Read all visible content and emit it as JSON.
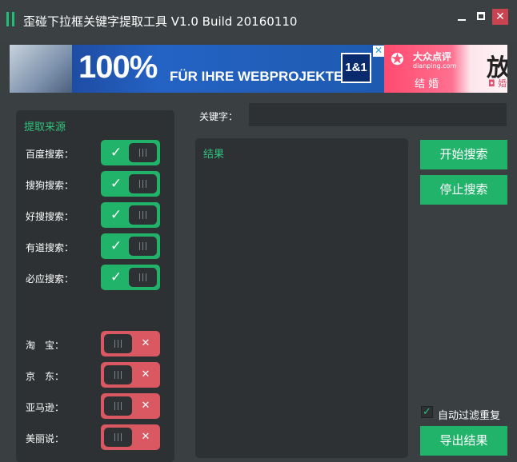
{
  "window": {
    "title": "歪碰下拉框关键字提取工具 V1.0 Build 20160110",
    "minimize_icon": "minimize-icon",
    "maximize_icon": "maximize-icon",
    "close_glyph": "✕"
  },
  "banner": {
    "ad1": {
      "big": "100%",
      "text": "FÜR IHRE WEBPROJEKTE",
      "logo": "1&1",
      "close": "✕"
    },
    "ad2": {
      "name": "大众点评",
      "url": "dianping.com",
      "tag": "结 婚",
      "big": "放",
      "sub": "◘ 婚"
    }
  },
  "sources": {
    "title": "提取来源",
    "items": [
      {
        "label": "百度搜索：",
        "enabled": true
      },
      {
        "label": "搜狗搜索：",
        "enabled": true
      },
      {
        "label": "好搜搜索：",
        "enabled": true
      },
      {
        "label": "有道搜索：",
        "enabled": true
      },
      {
        "label": "必应搜索：",
        "enabled": true
      },
      {
        "label": "淘　宝：",
        "enabled": false
      },
      {
        "label": "京　东：",
        "enabled": false
      },
      {
        "label": "亚马逊：",
        "enabled": false
      },
      {
        "label": "美丽说：",
        "enabled": false
      }
    ],
    "on_glyph": "✓",
    "off_glyph": "✕"
  },
  "keyword": {
    "label": "关键字：",
    "value": ""
  },
  "result": {
    "title": "结果"
  },
  "buttons": {
    "start": "开始搜索",
    "stop": "停止搜索",
    "export": "导出结果"
  },
  "filter": {
    "label": "自动过滤重复",
    "checked": true,
    "glyph": "✓"
  },
  "colors": {
    "accent": "#22b36a",
    "off": "#d95862",
    "bg": "#3a3f42",
    "panel": "#2d3133"
  }
}
